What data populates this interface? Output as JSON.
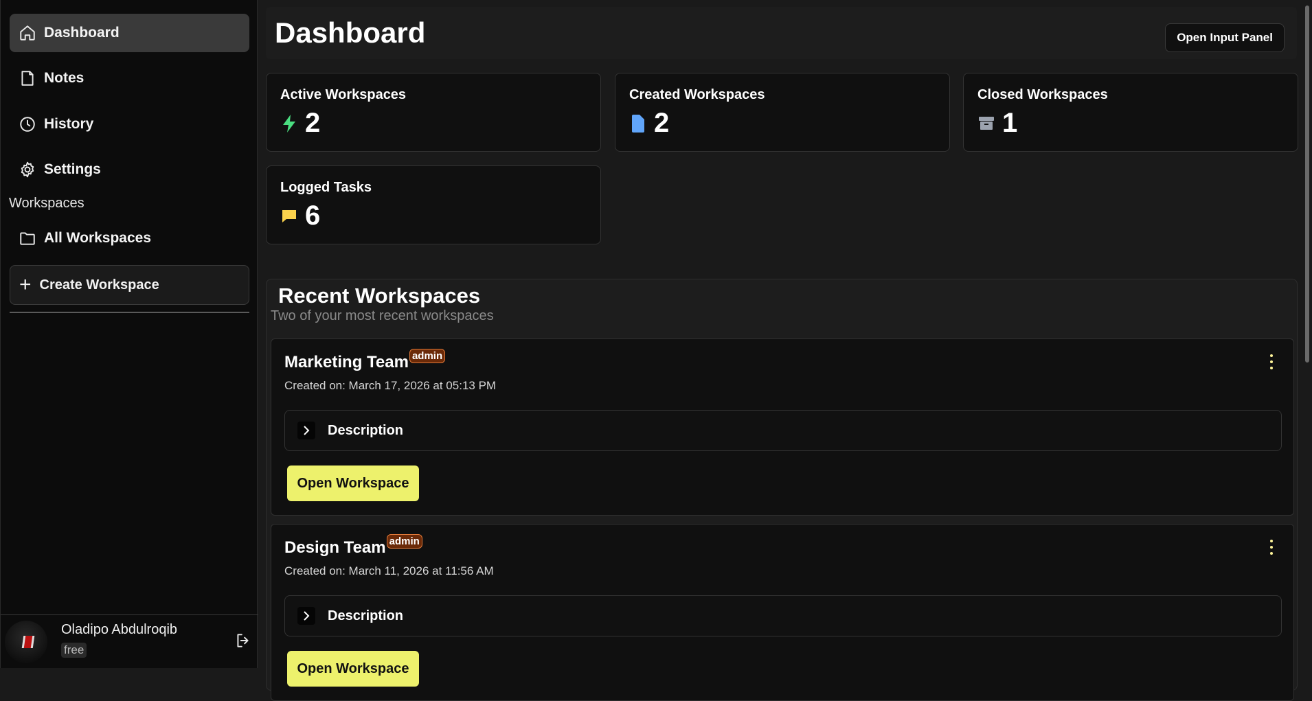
{
  "sidebar": {
    "nav": [
      {
        "label": "Dashboard",
        "icon": "home-icon",
        "active": true
      },
      {
        "label": "Notes",
        "icon": "note-icon"
      },
      {
        "label": "History",
        "icon": "clock-icon"
      },
      {
        "label": "Settings",
        "icon": "gear-icon"
      }
    ],
    "section_label": "Workspaces",
    "all_workspaces": "All Workspaces",
    "create_workspace": "Create Workspace",
    "user": {
      "name": "Oladipo Abdulroqib",
      "plan": "free"
    }
  },
  "header": {
    "title": "Dashboard",
    "open_input_panel": "Open Input Panel"
  },
  "stats": [
    {
      "label": "Active Workspaces",
      "value": "2",
      "icon": "bolt-icon",
      "color": "#4ade80"
    },
    {
      "label": "Created Workspaces",
      "value": "2",
      "icon": "file-icon",
      "color": "#60a5fa"
    },
    {
      "label": "Closed Workspaces",
      "value": "1",
      "icon": "archive-icon",
      "color": "#9ca3af"
    },
    {
      "label": "Logged Tasks",
      "value": "6",
      "icon": "message-icon",
      "color": "#fcd34d"
    }
  ],
  "recent": {
    "title": "Recent Workspaces",
    "subtitle": "Two of your most recent workspaces",
    "workspaces": [
      {
        "name": "Marketing Team",
        "role": "admin",
        "created": "Created on: March 17, 2026 at 05:13 PM",
        "description_label": "Description",
        "open_label": "Open Workspace"
      },
      {
        "name": "Design Team",
        "role": "admin",
        "created": "Created on: March 11, 2026 at 11:56 AM",
        "description_label": "Description",
        "open_label": "Open Workspace"
      }
    ]
  },
  "colors": {
    "accent": "#edf16c",
    "badge_bg": "#6b2a08",
    "badge_border": "#e07a3a"
  }
}
